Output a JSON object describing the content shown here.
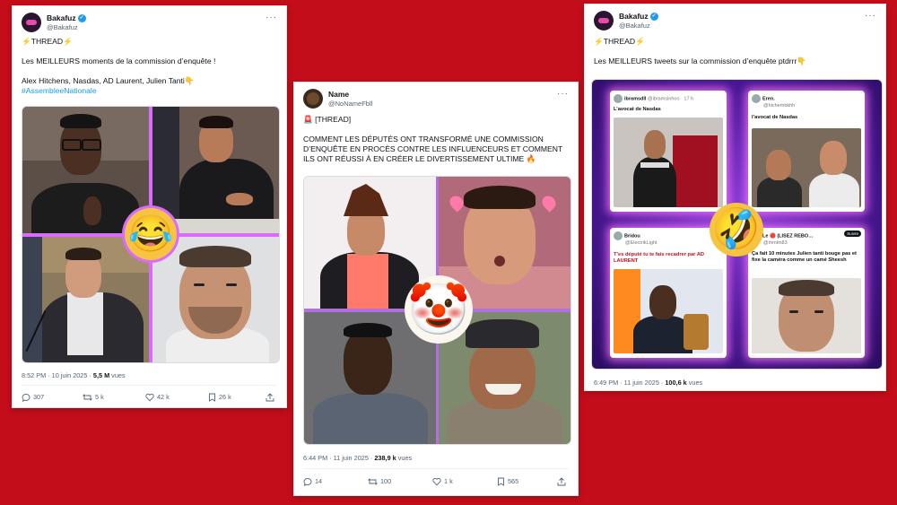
{
  "colors": {
    "background": "#c40d1a",
    "link": "#1d9bf0",
    "muted": "#536471",
    "accent": "#e84aa8"
  },
  "tweets": [
    {
      "name": "Bakafuz",
      "handle": "@Bakafuz",
      "lines": [
        "⚡THREAD⚡",
        "",
        "Les MEILLEURS moments de la commission d’enquête !",
        "",
        "Alex Hitchens, Nasdas, AD Laurent, Julien Tanti👇"
      ],
      "hashtag": "#AssembleeNationale",
      "emoji": "😂",
      "time": "8:52 PM · 10 juin 2025 · ",
      "views": "5,5 M",
      "views_label": " vues",
      "replies": "307",
      "reposts": "5 k",
      "likes": "42 k",
      "bookmarks": "26 k"
    },
    {
      "name": "Name",
      "handle": "@NoNameFbll",
      "lines": [
        "🚨 [THREAD]",
        "",
        "COMMENT LES DÉPUTÉS ONT TRANSFORMÉ UNE COMMISSION",
        "D’ENQUÊTE EN PROCÈS CONTRE LES INFLUENCEURS ET COMMENT",
        "ILS ONT RÉUSSI À EN CRÉER LE DIVERTISSEMENT ULTIME 🔥"
      ],
      "emoji": "🤡",
      "time": "6:44 PM · 11 juin 2025 · ",
      "views": "238,9 k",
      "views_label": " vues",
      "replies": "14",
      "reposts": "100",
      "likes": "1 k",
      "bookmarks": "565"
    },
    {
      "name": "Bakafuz",
      "handle": "@Bakafuz",
      "lines": [
        "⚡THREAD⚡",
        "",
        "Les MEILLEURS tweets sur la commission d’enquête ptdrrr👇"
      ],
      "emoji": "🤣",
      "time": "6:49 PM · 11 juin 2025 · ",
      "views": "100,6 k",
      "views_label": " vues",
      "mini": [
        {
          "name": "ibramsdll",
          "handle": "@ibramsinhoo · 17 h",
          "text": "L’avocat de Nasdas"
        },
        {
          "name": "Eren.",
          "handle": "@hichembkhh",
          "text": "l’avocat de Nasdas"
        },
        {
          "name": "Bridou",
          "handle": "@ElectrikLight",
          "text": "T’es député tu te fais recadrer par AD LAURENT"
        },
        {
          "name": "Le 🔴 (LISEZ REBO…",
          "handle": "@mmlm83",
          "text": "Ça fait 10 minutes Julien tanti bouge pas et fixe la caméra comme un camé Sheesh",
          "follow": "Suivre"
        }
      ]
    }
  ]
}
